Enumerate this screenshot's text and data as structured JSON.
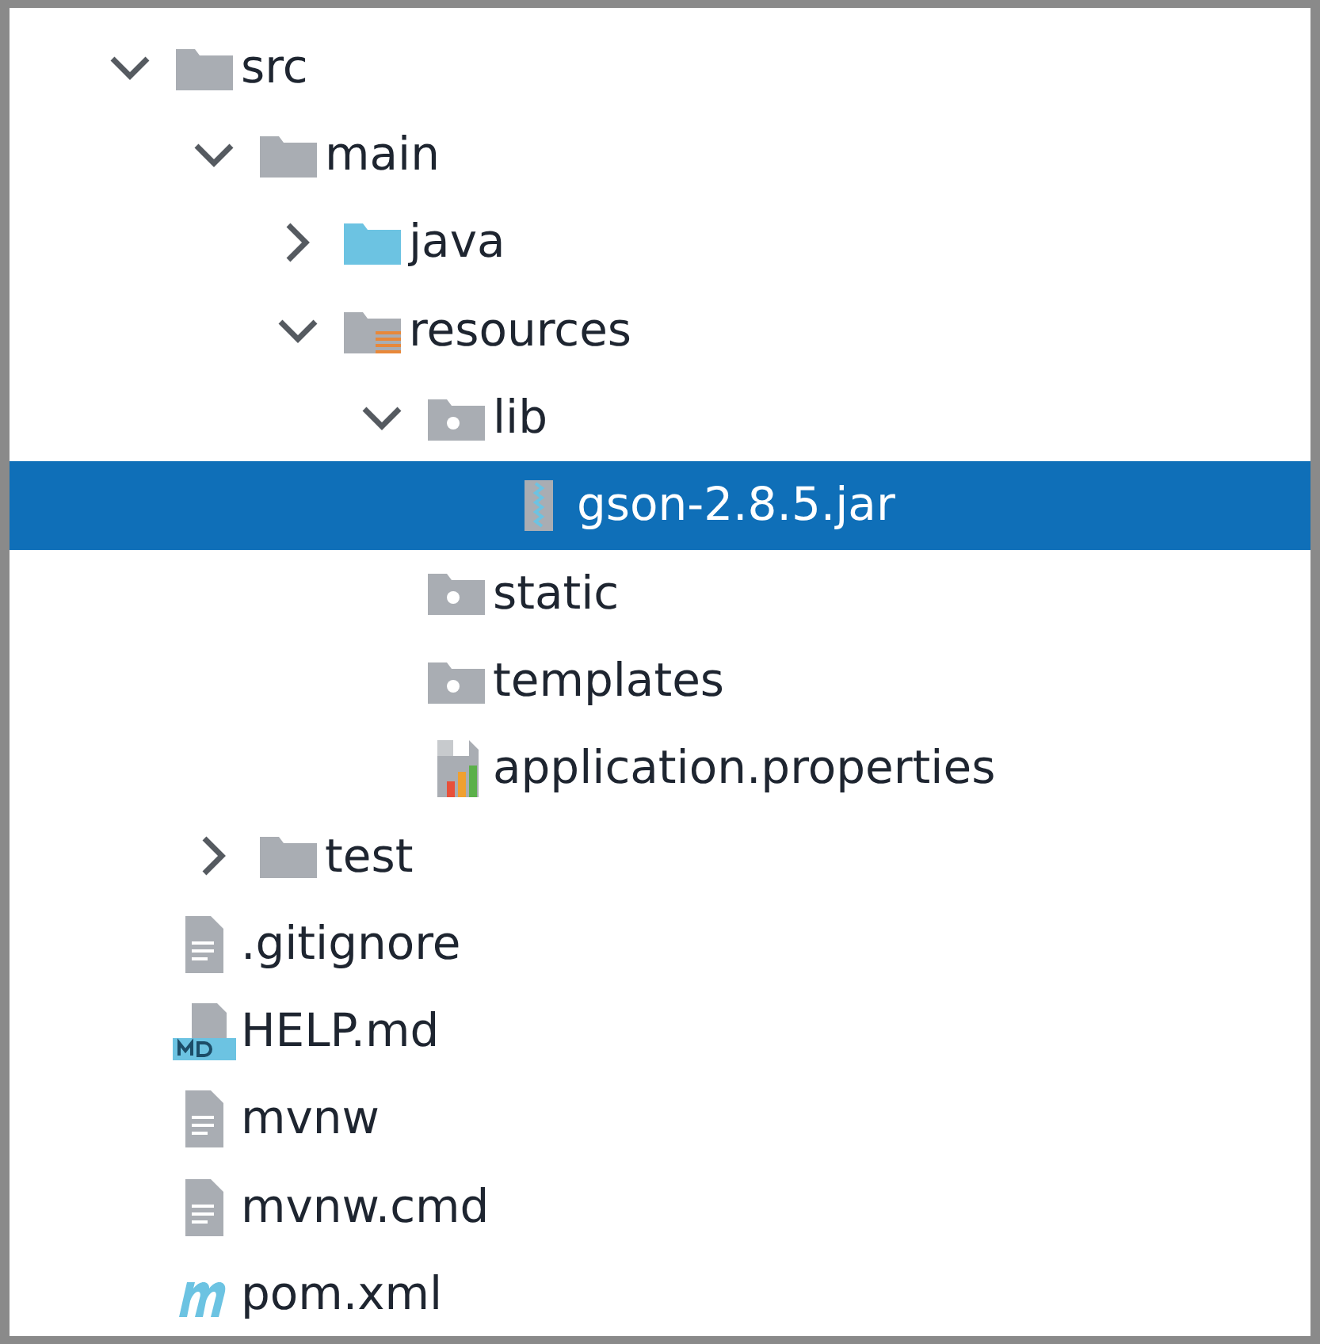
{
  "tree": [
    {
      "name": "src",
      "kind": "folder",
      "selected": false,
      "expanded": true,
      "children": [
        {
          "name": "main",
          "kind": "folder",
          "selected": false,
          "expanded": true,
          "children": [
            {
              "name": "java",
              "kind": "source-folder",
              "selected": false,
              "expanded": false
            },
            {
              "name": "resources",
              "kind": "resources-folder",
              "selected": false,
              "expanded": true,
              "children": [
                {
                  "name": "lib",
                  "kind": "package-folder",
                  "selected": false,
                  "expanded": true,
                  "children": [
                    {
                      "name": "gson-2.8.5.jar",
                      "kind": "jar",
                      "selected": true
                    }
                  ]
                },
                {
                  "name": "static",
                  "kind": "package-folder",
                  "selected": false
                },
                {
                  "name": "templates",
                  "kind": "package-folder",
                  "selected": false
                },
                {
                  "name": "application.properties",
                  "kind": "properties",
                  "selected": false
                }
              ]
            }
          ]
        },
        {
          "name": "test",
          "kind": "folder",
          "selected": false,
          "expanded": false
        }
      ]
    },
    {
      "name": ".gitignore",
      "kind": "text-file",
      "selected": false
    },
    {
      "name": "HELP.md",
      "kind": "markdown",
      "selected": false
    },
    {
      "name": "mvnw",
      "kind": "text-file",
      "selected": false
    },
    {
      "name": "mvnw.cmd",
      "kind": "text-file",
      "selected": false
    },
    {
      "name": "pom.xml",
      "kind": "maven",
      "selected": false
    }
  ]
}
